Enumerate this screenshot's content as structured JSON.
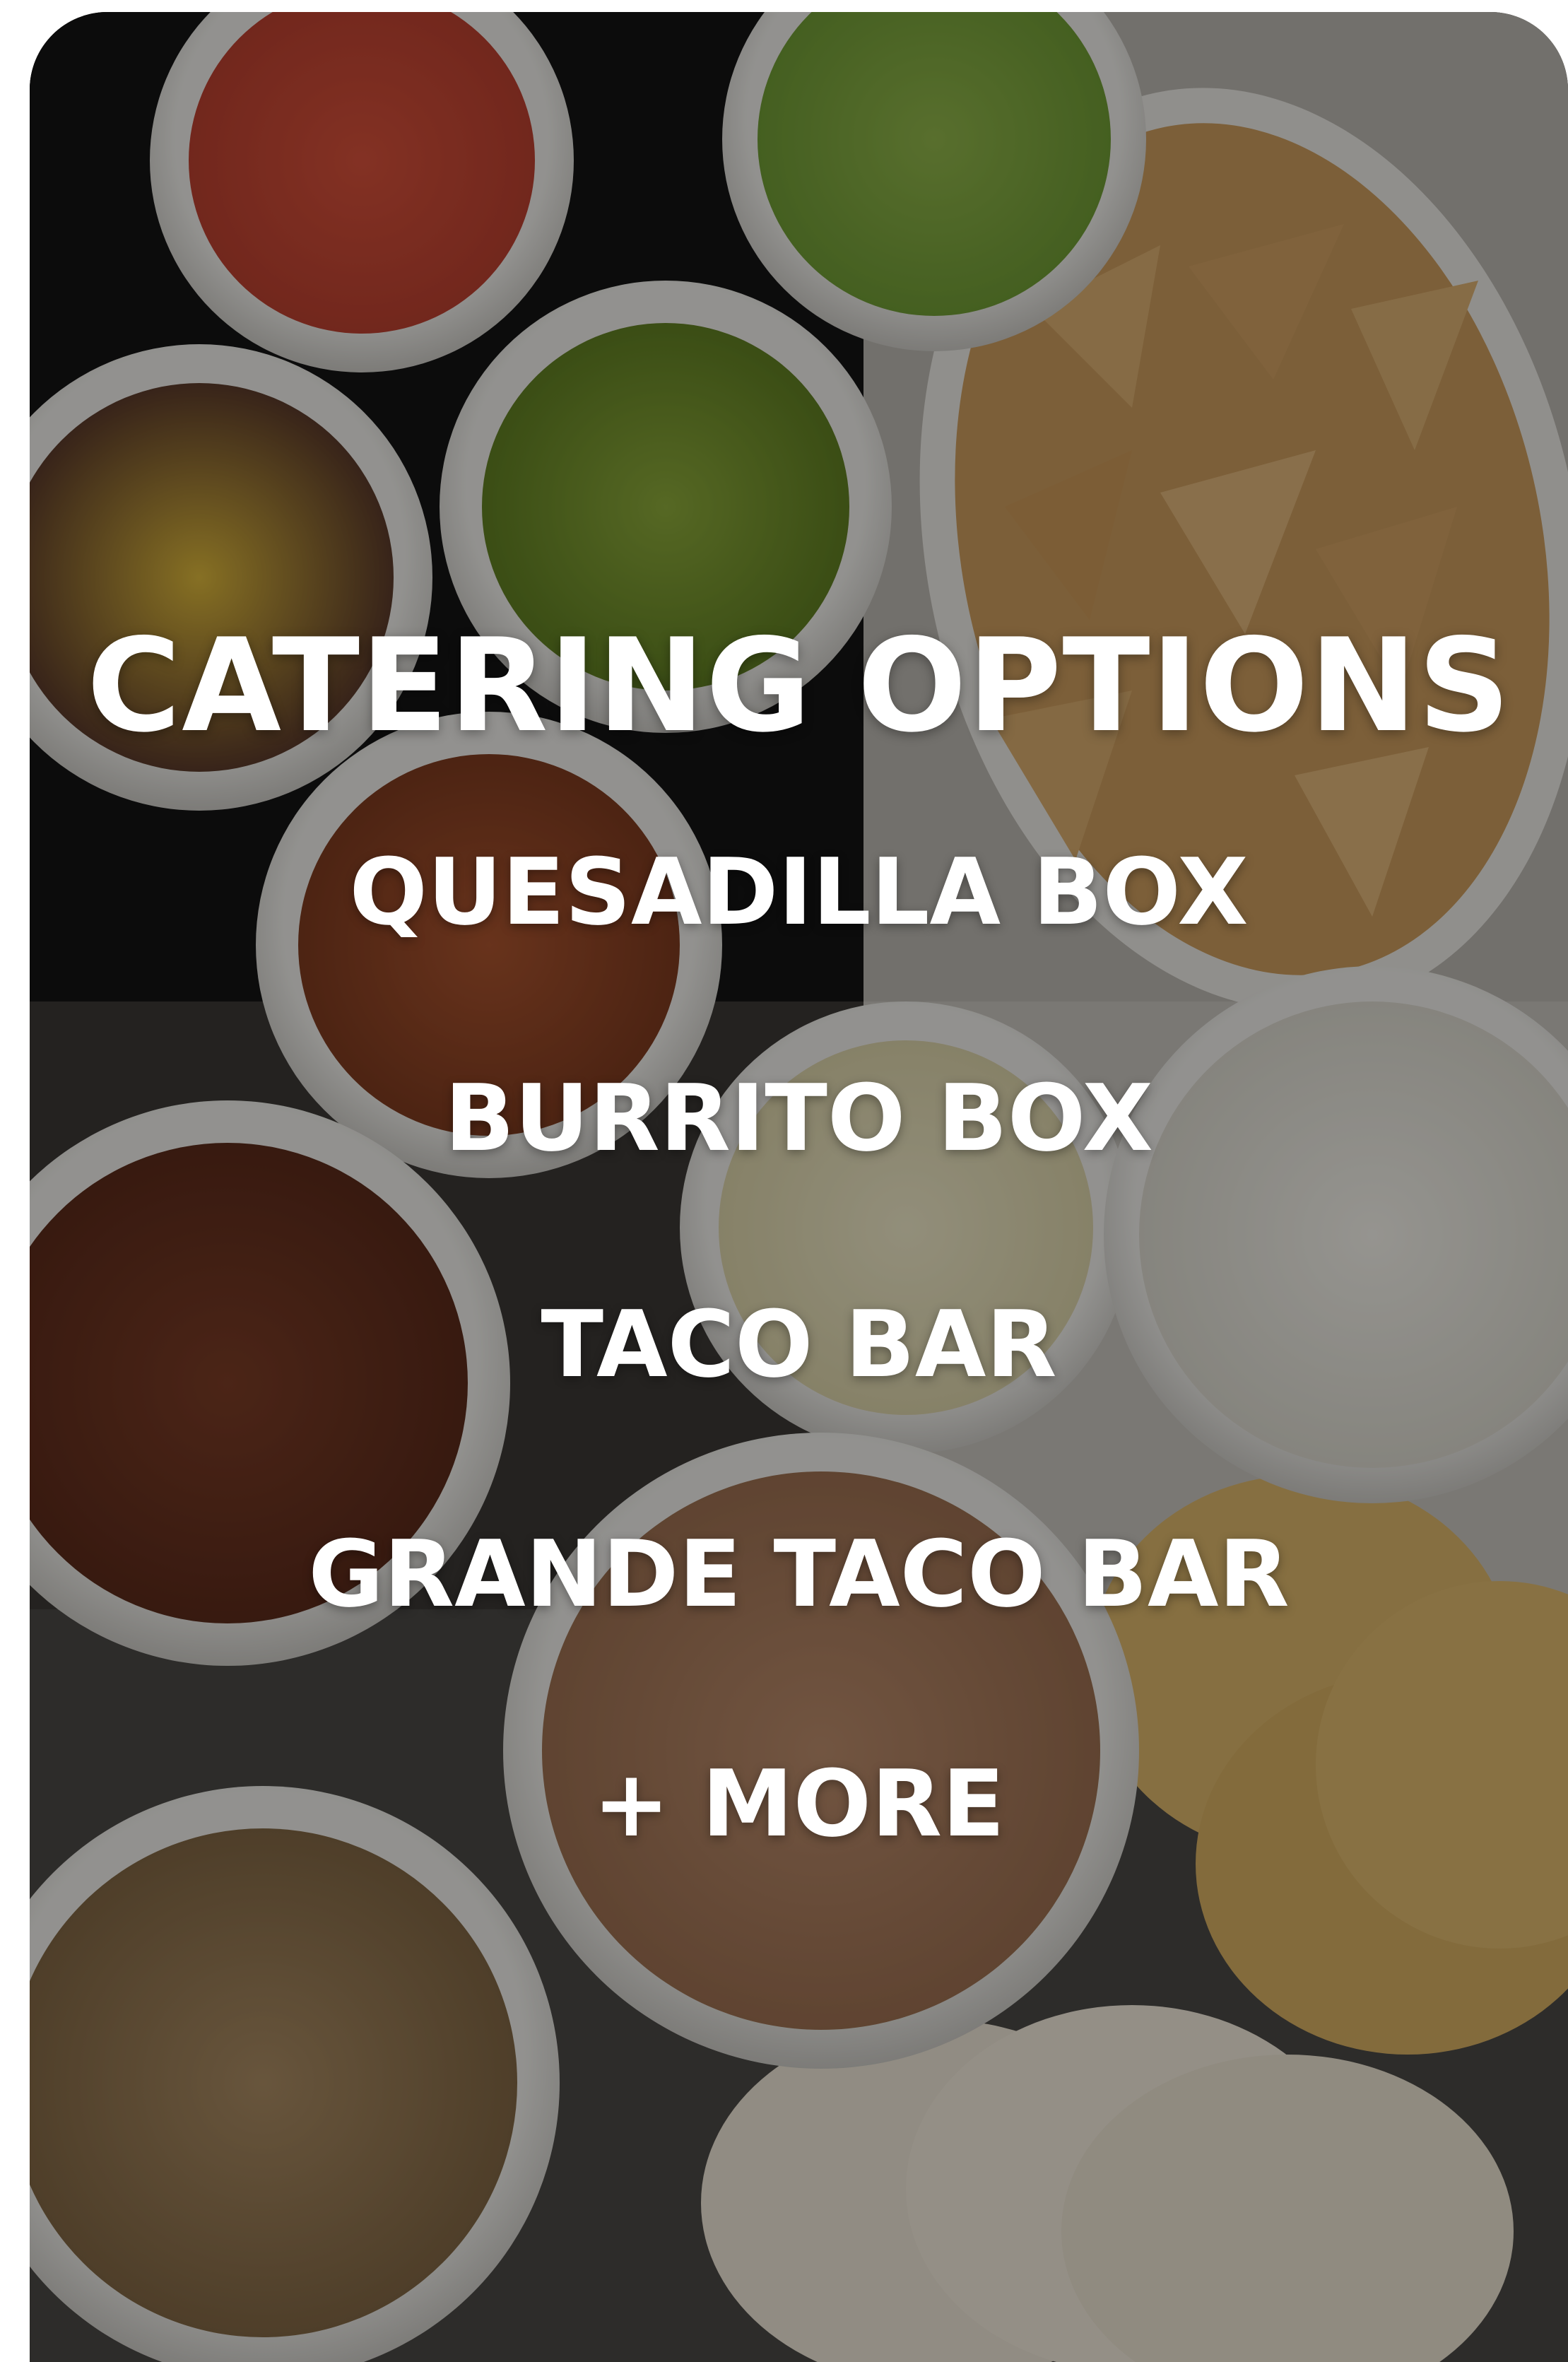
{
  "hero": {
    "title": "CATERING OPTIONS",
    "background_image": "mexican-food-spread"
  },
  "menu": {
    "items": [
      {
        "label": "QUESADILLA BOX"
      },
      {
        "label": "BURRITO BOX"
      },
      {
        "label": "TACO BAR"
      },
      {
        "label": "GRANDE TACO BAR"
      },
      {
        "label": "+ MORE"
      }
    ]
  },
  "colors": {
    "text": "#ffffff",
    "overlay": "#000000"
  }
}
